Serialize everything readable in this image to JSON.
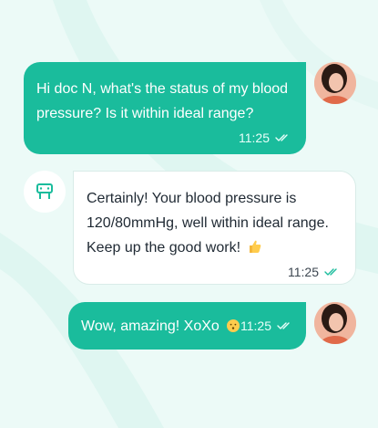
{
  "conversation": {
    "messages": [
      {
        "sender": "patient",
        "text": "Hi doc N, what's the status of my blood pressure? Is it within ideal range?",
        "time": "11:25",
        "status_icon": "double-check-icon"
      },
      {
        "sender": "doctor",
        "text": "Certainly! Your blood pressure is 120/80mmHg, well within ideal range. Keep up the good work!",
        "emoji": "thumbs-up-icon",
        "time": "11:25",
        "status_icon": "double-check-icon"
      },
      {
        "sender": "patient",
        "text": "Wow, amazing! XoXo",
        "emoji": "kissing-face-icon",
        "time": "11:25",
        "status_icon": "double-check-icon"
      }
    ]
  },
  "colors": {
    "accent": "#1abc9c",
    "background": "#ecfaf7",
    "doctor_bubble": "#ffffff"
  }
}
